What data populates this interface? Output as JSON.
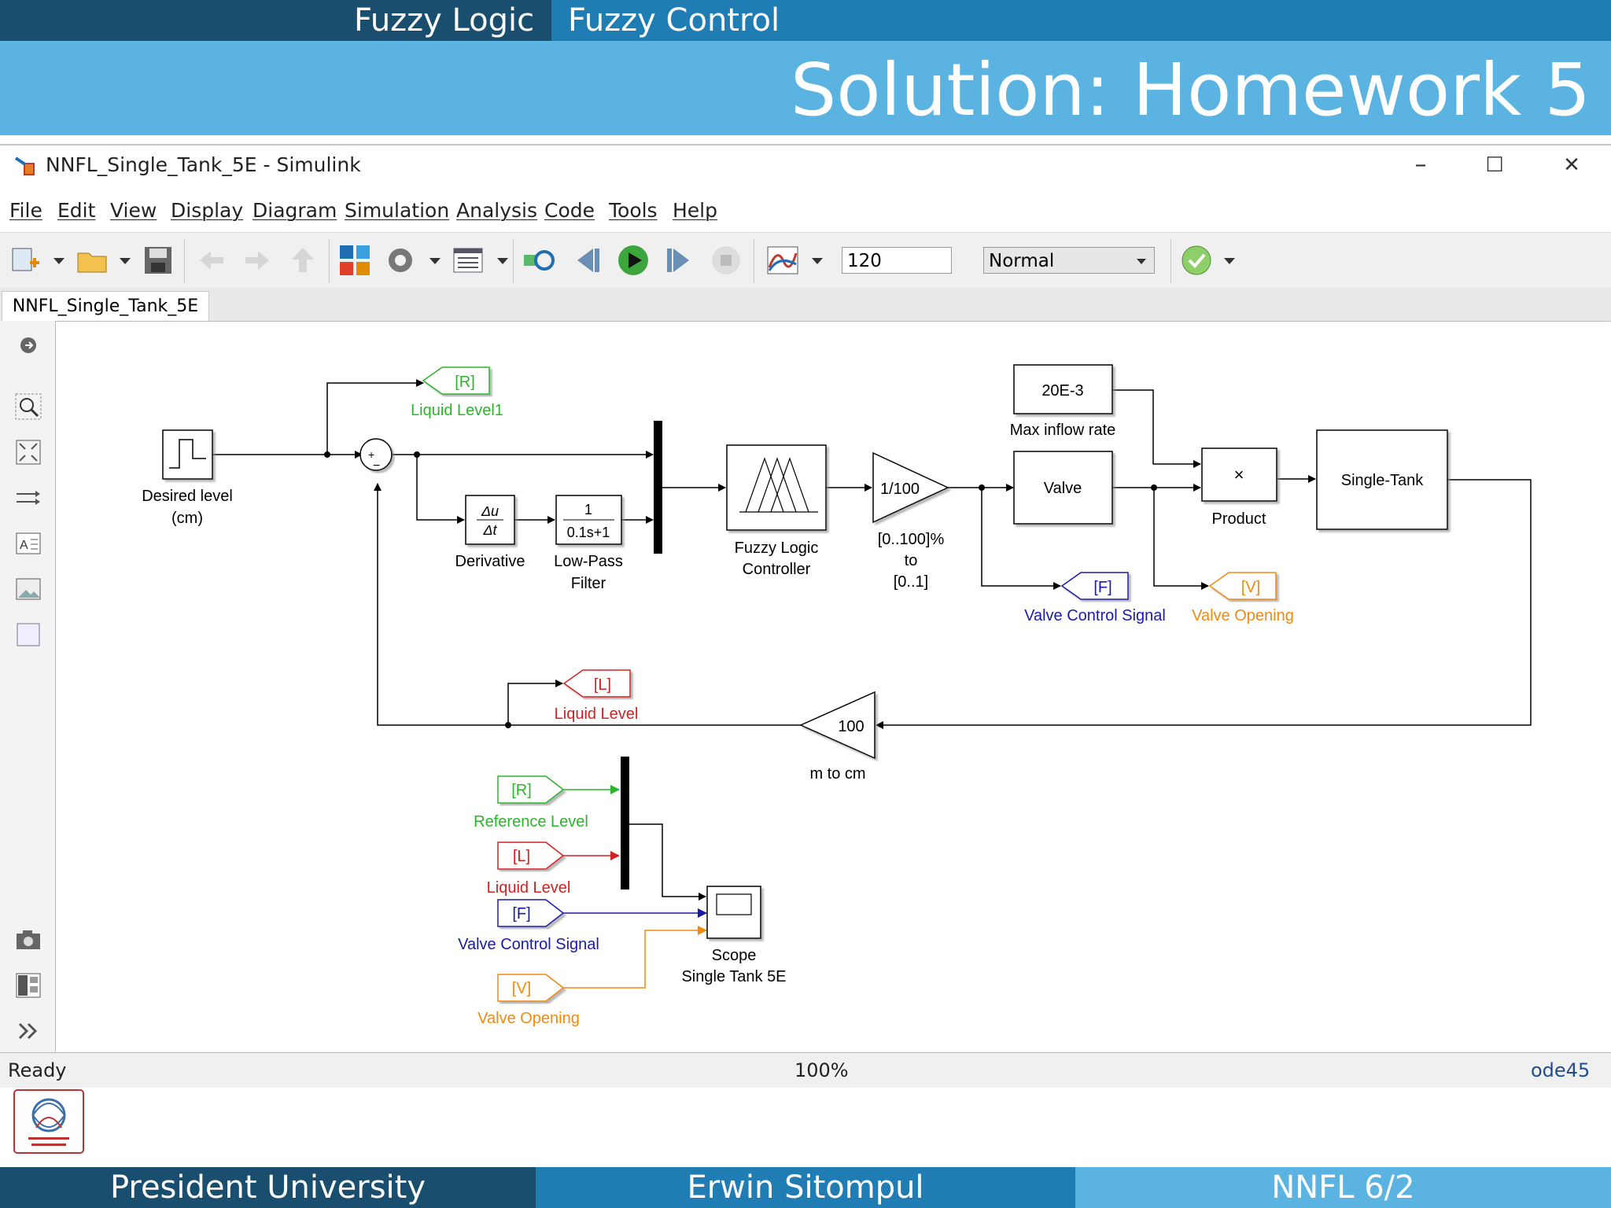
{
  "slide": {
    "header_left": "Fuzzy Logic",
    "header_right": "Fuzzy Control",
    "title": "Solution: Homework 5",
    "footer_left": "President University",
    "footer_center": "Erwin Sitompul",
    "footer_right": "NNFL 6/2"
  },
  "colors": {
    "dark_blue": "#1a4e6f",
    "mid_blue": "#1f7db3",
    "light_blue": "#5ab3e0"
  },
  "window": {
    "title": "NNFL_Single_Tank_5E - Simulink",
    "controls": {
      "minimize": "–",
      "maximize": "☐",
      "close": "✕"
    }
  },
  "menu": [
    "File",
    "Edit",
    "View",
    "Display",
    "Diagram",
    "Simulation",
    "Analysis",
    "Code",
    "Tools",
    "Help"
  ],
  "toolbar": {
    "stop_time": "120",
    "sim_mode": "Normal"
  },
  "tab": {
    "label": "NNFL_Single_Tank_5E"
  },
  "status": {
    "left": "Ready",
    "center": "100%",
    "right": "ode45"
  },
  "diagram": {
    "desired_level": [
      "Desired level",
      "(cm)"
    ],
    "goto_r_tag": "[R]",
    "goto_r_label": "Liquid Level1",
    "derivative_num": "Δu",
    "derivative_den": "Δt",
    "derivative_label": "Derivative",
    "lpf_num": "1",
    "lpf_den": "0.1s+1",
    "lpf_label": [
      "Low-Pass",
      "Filter"
    ],
    "flc_label": [
      "Fuzzy Logic",
      "Controller"
    ],
    "gain1_value": "1/100",
    "gain1_label": [
      "[0..100]%",
      "to",
      "[0..1]"
    ],
    "const_value": "20E-3",
    "const_label": "Max inflow rate",
    "valve": "Valve",
    "product_sym": "×",
    "product_label": "Product",
    "tank": "Single-Tank",
    "goto_f_tag": "[F]",
    "goto_f_label": "Valve Control Signal",
    "goto_v_tag": "[V]",
    "goto_v_label": "Valve Opening",
    "goto_l_tag": "[L]",
    "goto_l_label": "Liquid Level",
    "gain2_value": "100",
    "gain2_label": "m to cm",
    "from_r_tag": "[R]",
    "from_r_label": "Reference Level",
    "from_l_tag": "[L]",
    "from_l_label": "Liquid Level",
    "from_f_tag": "[F]",
    "from_f_label": "Valve Control Signal",
    "from_v_tag": "[V]",
    "from_v_label": "Valve Opening",
    "scope_label": [
      "Scope",
      "Single Tank 5E"
    ],
    "sum_plus": "+",
    "sum_minus": "−"
  },
  "icons": [
    "new-model-icon",
    "open-icon",
    "save-icon",
    "back-icon",
    "forward-icon",
    "up-icon",
    "library-icon",
    "settings-icon",
    "model-explorer-icon",
    "step-back-icon",
    "run-icon",
    "step-forward-icon",
    "stop-icon",
    "data-inspector-icon",
    "check-icon"
  ]
}
